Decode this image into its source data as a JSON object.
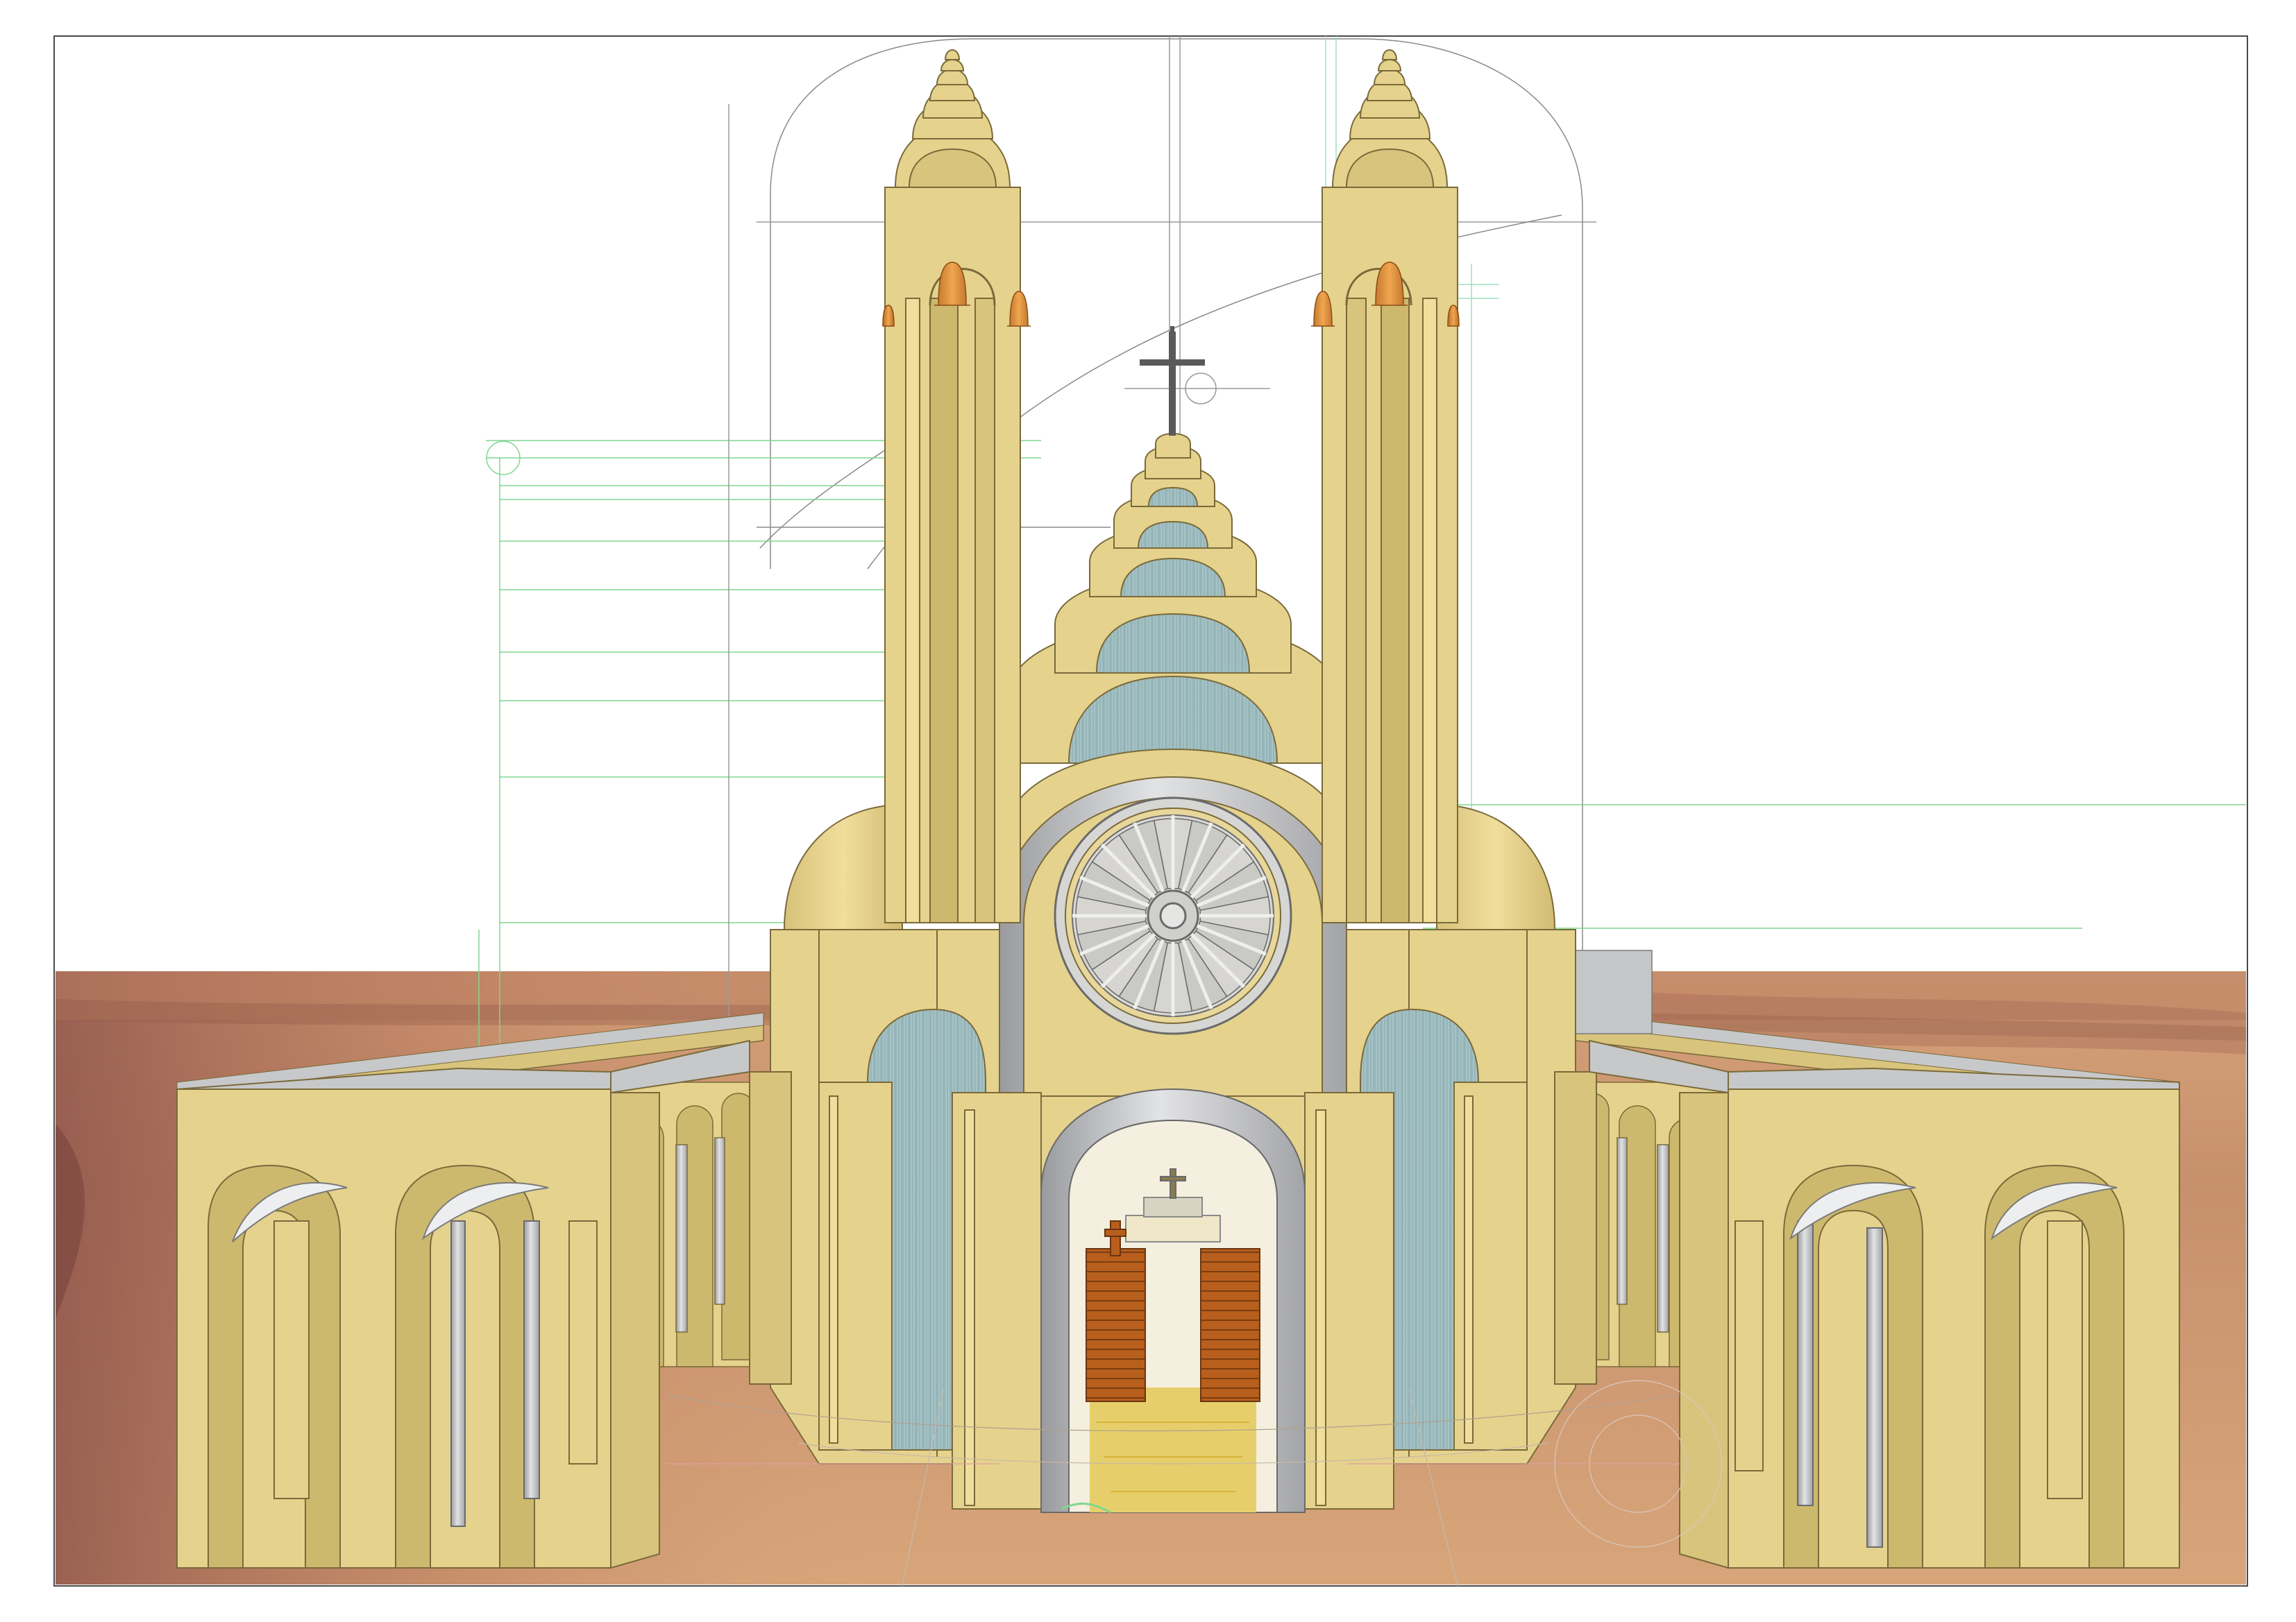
{
  "drawing": {
    "subject": "church-front-elevation",
    "footer_text": "",
    "has_cross": true,
    "bell_count": 4,
    "rose_window_spokes": 16
  },
  "colors": {
    "sheet_background": "#ffffff",
    "frame_line": "#4a4a4a",
    "ground_light": "#d9a776",
    "ground_dark": "#b5735a",
    "ground_shadow": "#7e4b44",
    "stone": "#e5d28d",
    "stone_shade": "#cdb96e",
    "stone_edge": "#7a6a3a",
    "glass": "#9fbcbf",
    "metal": "#c8c9cb",
    "metal_dark": "#8f9093",
    "bell": "#d28a3a",
    "pew": "#b5601e",
    "guide_green": "#7fd68f",
    "guide_gray": "#9a9a9a",
    "cross": "#5a5a5a"
  }
}
